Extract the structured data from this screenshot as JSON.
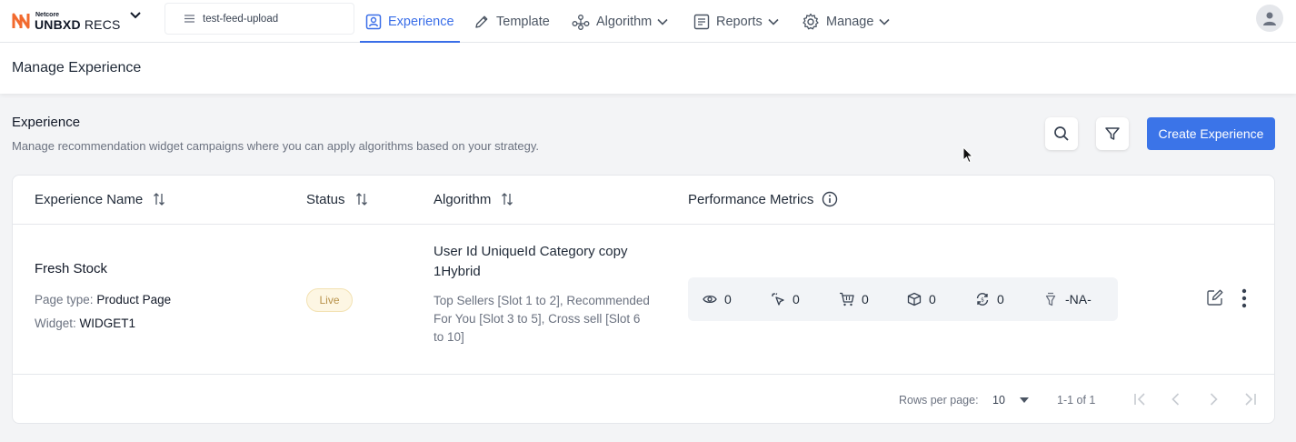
{
  "brand": {
    "small": "Netcore",
    "name_bold": "UNBXD",
    "name_light": "RECS"
  },
  "feed": {
    "value": "test-feed-upload"
  },
  "nav": {
    "experience": "Experience",
    "template": "Template",
    "algorithm": "Algorithm",
    "reports": "Reports",
    "manage": "Manage"
  },
  "page": {
    "title": "Manage Experience"
  },
  "section": {
    "title": "Experience",
    "description": "Manage recommendation widget campaigns where you can apply algorithms based on your strategy.",
    "create_button": "Create Experience"
  },
  "table": {
    "headers": {
      "name": "Experience Name",
      "status": "Status",
      "algorithm": "Algorithm",
      "metrics": "Performance Metrics"
    },
    "rows": [
      {
        "name": "Fresh Stock",
        "page_type_label": "Page type:",
        "page_type": "Product Page",
        "widget_label": "Widget:",
        "widget": "WIDGET1",
        "status": "Live",
        "algorithm_name": "User Id UniqueId Category copy 1Hybrid",
        "algorithm_detail": "Top Sellers [Slot 1 to 2], Recommended For You [Slot 3 to 5], Cross sell [Slot 6 to 10]",
        "metrics": {
          "views": "0",
          "clicks": "0",
          "add_to_cart": "0",
          "orders": "0",
          "conversion": "0",
          "revenue": "-NA-"
        }
      }
    ]
  },
  "pagination": {
    "rows_per_page_label": "Rows per page:",
    "rows_per_page": "10",
    "range": "1-1 of 1"
  },
  "colors": {
    "accent": "#3b74e8",
    "live_badge_bg": "#fdf6e3",
    "live_badge_text": "#b8924a",
    "brand_orange": "#f26a2e"
  }
}
